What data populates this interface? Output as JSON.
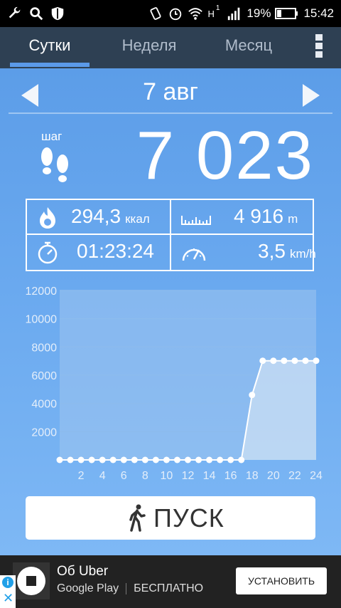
{
  "status": {
    "network": "H",
    "sim": "1",
    "battery": "19%",
    "time": "15:42"
  },
  "tabs": [
    {
      "label": "Сутки",
      "active": true
    },
    {
      "label": "Неделя",
      "active": false
    },
    {
      "label": "Месяц",
      "active": false
    }
  ],
  "date": "7 авг",
  "steps": {
    "label": "шаг",
    "value": "7 023"
  },
  "stats": {
    "calories": {
      "value": "294,3",
      "unit": "ккал"
    },
    "distance": {
      "value": "4 916",
      "unit": "m"
    },
    "duration": {
      "value": "01:23:24"
    },
    "speed": {
      "value": "3,5",
      "unit": "km/h"
    }
  },
  "chart_data": {
    "type": "area",
    "x": [
      0,
      1,
      2,
      3,
      4,
      5,
      6,
      7,
      8,
      9,
      10,
      11,
      12,
      13,
      14,
      15,
      16,
      17,
      18,
      19,
      20,
      21,
      22,
      23,
      24
    ],
    "values": [
      0,
      0,
      0,
      0,
      0,
      0,
      0,
      0,
      0,
      0,
      0,
      0,
      0,
      0,
      0,
      0,
      0,
      0,
      4600,
      7023,
      7023,
      7023,
      7023,
      7023,
      7023
    ],
    "xticks": [
      "2",
      "4",
      "6",
      "8",
      "10",
      "12",
      "14",
      "16",
      "18",
      "20",
      "22",
      "24"
    ],
    "yticks": [
      "2000",
      "4000",
      "6000",
      "8000",
      "10000",
      "12000"
    ],
    "ylim": [
      0,
      12000
    ],
    "xlim": [
      0,
      24
    ],
    "grid": true,
    "colors": {
      "line": "#ffffff",
      "fill": "#dbe7f5"
    }
  },
  "start_button": {
    "label": "ПУСК"
  },
  "ad": {
    "title": "Об Uber",
    "store": "Google Play",
    "price": "БЕСПЛАТНО",
    "install": "УСТАНОВИТЬ"
  }
}
